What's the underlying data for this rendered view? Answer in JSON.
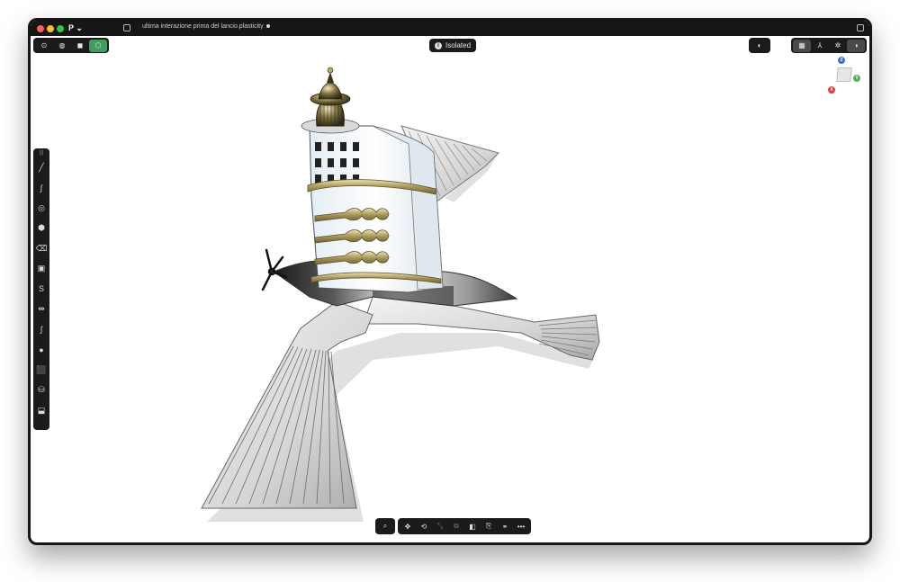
{
  "titlebar": {
    "app_menu": "P ⌄",
    "document_title": "ultima interazione prima del lancio.plasticity"
  },
  "mode_toolbar": {
    "items": [
      {
        "name": "vertex-mode",
        "icon": "vertex-select-icon",
        "glyph": "⊙"
      },
      {
        "name": "edge-mode",
        "icon": "edge-select-icon",
        "glyph": "◍"
      },
      {
        "name": "face-mode",
        "icon": "face-select-icon",
        "glyph": "◼"
      },
      {
        "name": "solid-mode",
        "icon": "solid-select-icon",
        "glyph": "⬡",
        "active": true
      }
    ]
  },
  "isolated_badge": {
    "label": "Isolated"
  },
  "render_toolbar": {
    "items": [
      {
        "name": "render-mode",
        "icon": "half-circle-icon",
        "glyph": "◐"
      }
    ]
  },
  "view_toolbar": {
    "items": [
      {
        "name": "grid-toggle",
        "icon": "grid-icon",
        "glyph": "▦",
        "selected": true
      },
      {
        "name": "orient-toggle",
        "icon": "axes-icon",
        "glyph": "⅄"
      },
      {
        "name": "snap-toggle",
        "icon": "snap-icon",
        "glyph": "✲"
      },
      {
        "name": "appearance-toggle",
        "icon": "appearance-icon",
        "glyph": "◑",
        "selected": true
      }
    ]
  },
  "viewcube": {
    "axis_z": "Z",
    "axis_y": "Y",
    "axis_x": "X"
  },
  "left_toolbar": {
    "grip": "|||",
    "tools": [
      {
        "name": "line-tool",
        "icon": "line-icon",
        "glyph": "╱"
      },
      {
        "name": "curve-tool",
        "icon": "curve-icon",
        "glyph": "∫"
      },
      {
        "name": "circle-tool",
        "icon": "circle-icon",
        "glyph": "◎"
      },
      {
        "name": "polygon-tool",
        "icon": "polygon-icon",
        "glyph": "⬢"
      },
      {
        "name": "trash-tool",
        "icon": "trash-icon",
        "glyph": "⌫"
      },
      {
        "name": "rectangle-tool",
        "icon": "rectangle-icon",
        "glyph": "▣"
      },
      {
        "name": "spline-tool",
        "icon": "spline-icon",
        "glyph": "S"
      },
      {
        "name": "mirror-tool",
        "icon": "mirror-icon",
        "glyph": "⇹"
      },
      {
        "name": "fillet-tool",
        "icon": "fillet-icon",
        "glyph": "ʃ"
      },
      {
        "name": "sphere-tool",
        "icon": "sphere-icon",
        "glyph": "●"
      },
      {
        "name": "box-tool",
        "icon": "box-icon",
        "glyph": "⬛"
      },
      {
        "name": "cylinder-tool",
        "icon": "cylinder-icon",
        "glyph": "⛁"
      },
      {
        "name": "extrude-tool",
        "icon": "extrude-icon",
        "glyph": "⬓"
      }
    ]
  },
  "bottom_toolbar": {
    "search": {
      "name": "search",
      "icon": "search-icon",
      "glyph": "⌕"
    },
    "items": [
      {
        "name": "move-tool",
        "icon": "move-icon",
        "glyph": "✥"
      },
      {
        "name": "rotate-tool",
        "icon": "rotate-icon",
        "glyph": "⟲"
      },
      {
        "name": "scale-tool",
        "icon": "scale-icon",
        "glyph": "⤡",
        "dim": true
      },
      {
        "name": "duplicate-tool",
        "icon": "duplicate-icon",
        "glyph": "⧉",
        "dim": true
      },
      {
        "name": "boolean-tool",
        "icon": "boolean-icon",
        "glyph": "◧"
      },
      {
        "name": "attach-tool",
        "icon": "paperclip-icon",
        "glyph": "⎘"
      },
      {
        "name": "group-tool",
        "icon": "group-icon",
        "glyph": "⚭"
      },
      {
        "name": "more",
        "icon": "more-icon",
        "glyph": "•••"
      }
    ]
  },
  "colors": {
    "toolbar_bg": "#1b1b1b",
    "accent_active": "#3f9d5e",
    "metal_light": "#eeeeee",
    "metal_dark": "#2a2a2a",
    "gold": "#b9a86a",
    "tower_white": "#e6eef4"
  }
}
